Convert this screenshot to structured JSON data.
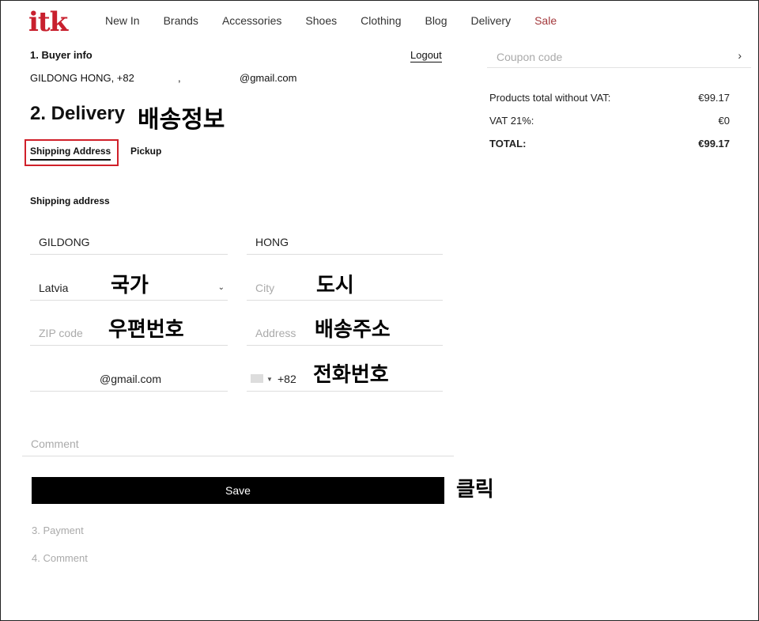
{
  "header": {
    "logo": "itk",
    "nav": [
      "New In",
      "Brands",
      "Accessories",
      "Shoes",
      "Clothing",
      "Blog",
      "Delivery"
    ],
    "sale": "Sale",
    "sale_color": "#a3383b",
    "logo_color": "#c8202e"
  },
  "buyer": {
    "title": "1. Buyer info",
    "logout": "Logout",
    "name_phone": "GILDONG HONG, +82",
    "comma": ",",
    "email": "@gmail.com"
  },
  "delivery": {
    "title": "2. Delivery",
    "tabs": {
      "shipping": "Shipping Address",
      "pickup": "Pickup"
    },
    "section_label": "Shipping address",
    "fields": {
      "first_name": "GILDONG",
      "last_name": "HONG",
      "country": "Latvia",
      "city_placeholder": "City",
      "zip_placeholder": "ZIP code",
      "address_placeholder": "Address",
      "email": "@gmail.com",
      "phone_code": "+82",
      "comment_placeholder": "Comment"
    },
    "save_label": "Save"
  },
  "steps": {
    "payment": "3. Payment",
    "comment": "4. Comment"
  },
  "summary": {
    "coupon_placeholder": "Coupon code",
    "coupon_arrow": "›",
    "rows": [
      {
        "label": "Products total without VAT:",
        "value": "€99.17"
      },
      {
        "label": "VAT 21%:",
        "value": "€0"
      },
      {
        "label": "TOTAL:",
        "value": "€99.17"
      }
    ]
  },
  "annotations": {
    "delivery": "배송정보",
    "country": "국가",
    "city": "도시",
    "zip": "우편번호",
    "address": "배송주소",
    "phone": "전화번호",
    "click": "클릭",
    "highlight_color": "#d0202a"
  }
}
